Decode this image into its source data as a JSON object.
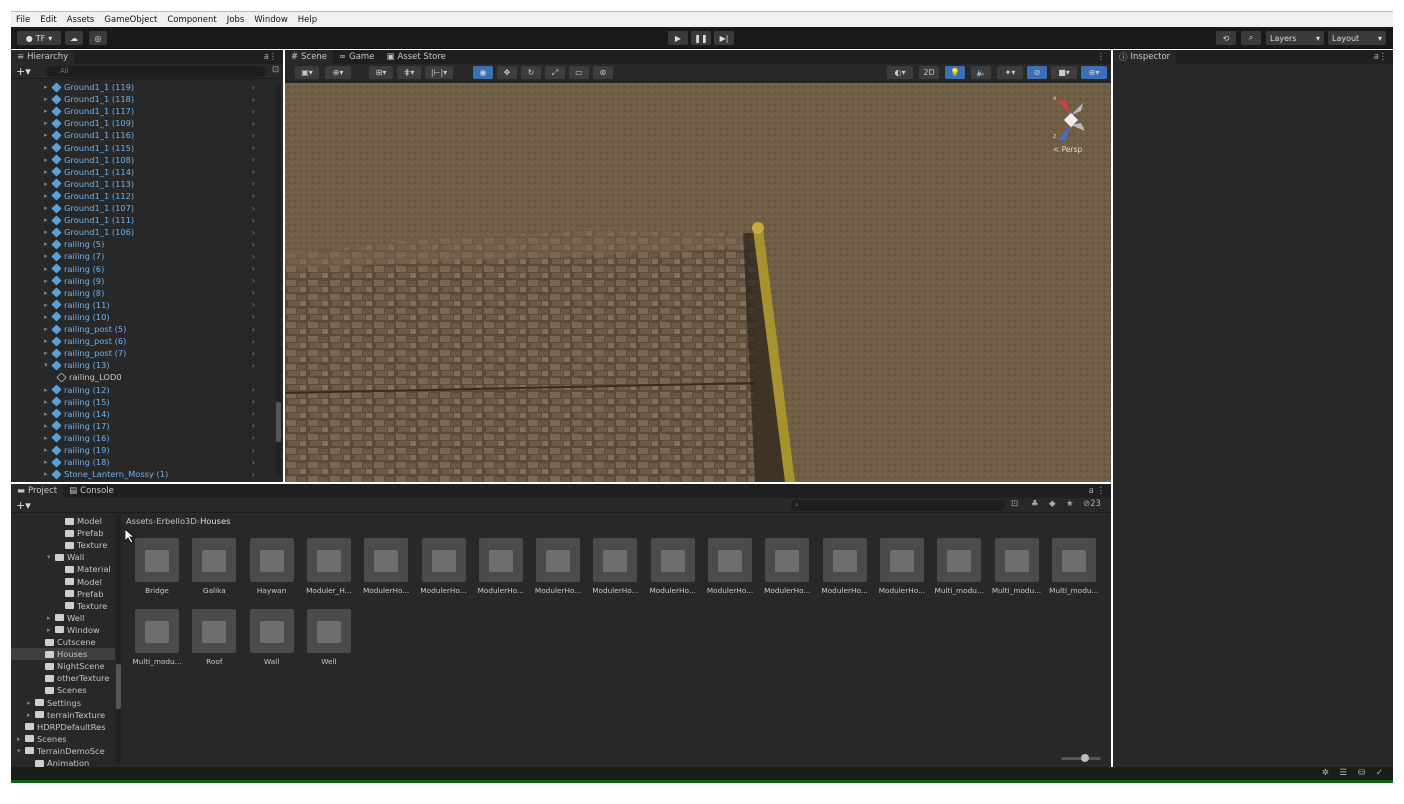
{
  "menu": [
    "File",
    "Edit",
    "Assets",
    "GameObject",
    "Component",
    "Jobs",
    "Window",
    "Help"
  ],
  "toolbar": {
    "account": "TF",
    "play_icon": "play-icon",
    "pause_icon": "pause-icon",
    "step_icon": "step-icon",
    "layers_label": "Layers",
    "layout_label": "Layout"
  },
  "hierarchy": {
    "title": "Hierarchy",
    "search_placeholder": "All",
    "items": [
      {
        "label": "Ground1_1 (119)",
        "type": "prefab",
        "indent": 3
      },
      {
        "label": "Ground1_1 (118)",
        "type": "prefab",
        "indent": 3
      },
      {
        "label": "Ground1_1 (117)",
        "type": "prefab",
        "indent": 3
      },
      {
        "label": "Ground1_1 (109)",
        "type": "prefab",
        "indent": 3
      },
      {
        "label": "Ground1_1 (116)",
        "type": "prefab",
        "indent": 3
      },
      {
        "label": "Ground1_1 (115)",
        "type": "prefab",
        "indent": 3
      },
      {
        "label": "Ground1_1 (108)",
        "type": "prefab",
        "indent": 3
      },
      {
        "label": "Ground1_1 (114)",
        "type": "prefab",
        "indent": 3
      },
      {
        "label": "Ground1_1 (113)",
        "type": "prefab",
        "indent": 3
      },
      {
        "label": "Ground1_1 (112)",
        "type": "prefab",
        "indent": 3
      },
      {
        "label": "Ground1_1 (107)",
        "type": "prefab",
        "indent": 3
      },
      {
        "label": "Ground1_1 (111)",
        "type": "prefab",
        "indent": 3
      },
      {
        "label": "Ground1_1 (106)",
        "type": "prefab",
        "indent": 3
      },
      {
        "label": "railing (5)",
        "type": "prefab",
        "indent": 3
      },
      {
        "label": "railing (7)",
        "type": "prefab",
        "indent": 3
      },
      {
        "label": "railing (6)",
        "type": "prefab",
        "indent": 3
      },
      {
        "label": "railing (9)",
        "type": "prefab",
        "indent": 3
      },
      {
        "label": "railing (8)",
        "type": "prefab",
        "indent": 3
      },
      {
        "label": "railing (11)",
        "type": "prefab",
        "indent": 3
      },
      {
        "label": "railing (10)",
        "type": "prefab",
        "indent": 3
      },
      {
        "label": "railing_post (5)",
        "type": "prefab",
        "indent": 3
      },
      {
        "label": "railing_post (6)",
        "type": "prefab",
        "indent": 3
      },
      {
        "label": "railing_post (7)",
        "type": "prefab",
        "indent": 3
      },
      {
        "label": "railing (13)",
        "type": "prefab",
        "indent": 3
      },
      {
        "label": "railing_LOD0",
        "type": "child",
        "indent": 4
      },
      {
        "label": "railing (12)",
        "type": "prefab",
        "indent": 3
      },
      {
        "label": "railing (15)",
        "type": "prefab",
        "indent": 3
      },
      {
        "label": "railing (14)",
        "type": "prefab",
        "indent": 3
      },
      {
        "label": "railing (17)",
        "type": "prefab",
        "indent": 3
      },
      {
        "label": "railing (16)",
        "type": "prefab",
        "indent": 3
      },
      {
        "label": "railing (19)",
        "type": "prefab",
        "indent": 3
      },
      {
        "label": "railing (18)",
        "type": "prefab",
        "indent": 3
      },
      {
        "label": "Stone_Lantern_Mossy (1)",
        "type": "prefab",
        "indent": 3
      }
    ]
  },
  "scene_tabs": [
    {
      "label": "Scene",
      "icon": "grid-icon"
    },
    {
      "label": "Game",
      "icon": "gamepad-icon"
    },
    {
      "label": "Asset Store",
      "icon": "store-icon"
    }
  ],
  "scene": {
    "persp_label": "< Persp",
    "btn_2d": "2D",
    "axis_x": "x",
    "axis_z": "z"
  },
  "inspector": {
    "title": "Inspector"
  },
  "bottom_tabs": [
    {
      "label": "Project"
    },
    {
      "label": "Console"
    }
  ],
  "project": {
    "tree": [
      {
        "label": "Model",
        "indent": 5,
        "expanded": null
      },
      {
        "label": "Prefab",
        "indent": 5,
        "expanded": null
      },
      {
        "label": "Texture",
        "indent": 5,
        "expanded": null
      },
      {
        "label": "Wall",
        "indent": 4,
        "expanded": true
      },
      {
        "label": "Material",
        "indent": 5,
        "expanded": null
      },
      {
        "label": "Model",
        "indent": 5,
        "expanded": null
      },
      {
        "label": "Prefab",
        "indent": 5,
        "expanded": null
      },
      {
        "label": "Texture",
        "indent": 5,
        "expanded": null
      },
      {
        "label": "Well",
        "indent": 4,
        "expanded": false
      },
      {
        "label": "Window",
        "indent": 4,
        "expanded": false
      },
      {
        "label": "Cutscene",
        "indent": 3,
        "expanded": null
      },
      {
        "label": "Houses",
        "indent": 3,
        "expanded": null,
        "selected": true
      },
      {
        "label": "NightScene",
        "indent": 3,
        "expanded": null
      },
      {
        "label": "otherTexture",
        "indent": 3,
        "expanded": null
      },
      {
        "label": "Scenes",
        "indent": 3,
        "expanded": null
      },
      {
        "label": "Settings",
        "indent": 2,
        "expanded": false
      },
      {
        "label": "terrainTexture",
        "indent": 2,
        "expanded": false
      },
      {
        "label": "HDRPDefaultRes",
        "indent": 1,
        "expanded": null
      },
      {
        "label": "Scenes",
        "indent": 1,
        "expanded": false
      },
      {
        "label": "TerrainDemoSce",
        "indent": 1,
        "expanded": true
      },
      {
        "label": "Animation",
        "indent": 2,
        "expanded": null
      }
    ],
    "breadcrumb": [
      "Assets",
      "Erbello3D",
      "Houses"
    ],
    "hidden_count": "23",
    "assets": [
      "Bridge",
      "Galika",
      "Haywan",
      "Moduler_H...",
      "ModulerHo...",
      "ModulerHo...",
      "ModulerHo...",
      "ModulerHo...",
      "ModulerHo...",
      "ModulerHo...",
      "ModulerHo...",
      "ModulerHo...",
      "ModulerHo...",
      "ModulerHo...",
      "Multi_modu...",
      "Multi_modu...",
      "Multi_modu...",
      "Multi_modu...",
      "Roof",
      "Wall",
      "Well"
    ]
  },
  "colors": {
    "accent": "#3d6fb6",
    "prefab": "#6fb3ee",
    "statusbar": "#0d5f14"
  }
}
